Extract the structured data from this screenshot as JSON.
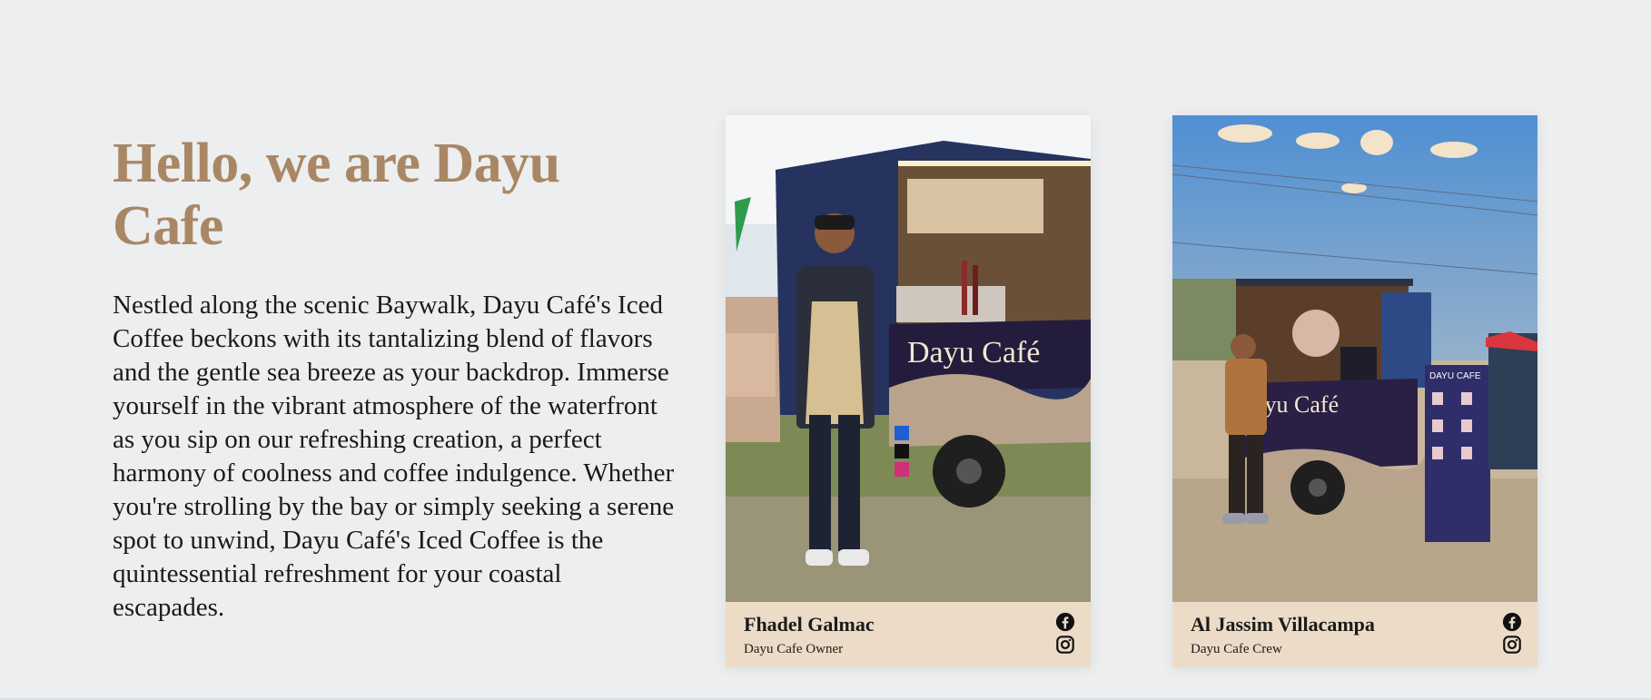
{
  "intro": {
    "title": "Hello, we are Dayu Cafe",
    "body": "Nestled along the scenic Baywalk, Dayu Café's Iced Coffee beckons with its tantalizing blend of flavors and the gentle sea breeze as your backdrop. Immerse yourself in the vibrant atmosphere of the waterfront as you sip on our refreshing creation, a perfect harmony of coolness and coffee indulgence. Whether you're strolling by the bay or simply seeking a serene spot to unwind, Dayu Café's Iced Coffee is the quintessential refreshment for your coastal escapades."
  },
  "team": [
    {
      "name": "Fhadel Galmac",
      "role": "Dayu Cafe Owner",
      "cart_sign": "Dayu Café",
      "icons": [
        "facebook-icon",
        "instagram-icon"
      ]
    },
    {
      "name": "Al Jassim Villacampa",
      "role": "Dayu Cafe Crew",
      "cart_sign": "ayu Café",
      "banner_text": "DAYU CAFE",
      "icons": [
        "facebook-icon",
        "instagram-icon"
      ]
    }
  ],
  "colors": {
    "page_bg": "#eceef0",
    "title": "#a98764",
    "card_footer": "#ecdcc7"
  }
}
